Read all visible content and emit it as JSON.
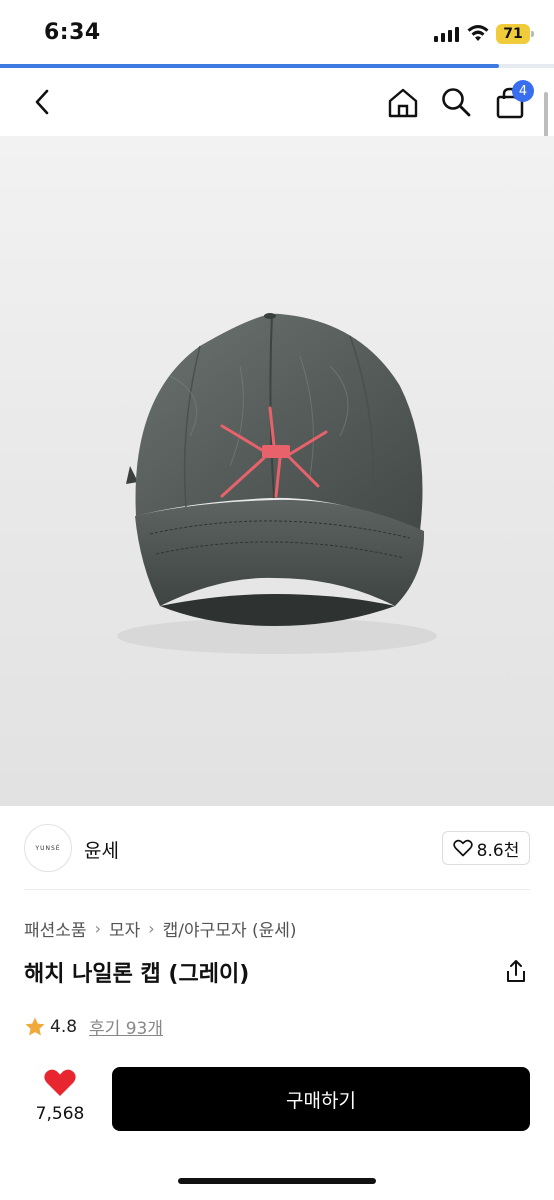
{
  "status_bar": {
    "time": "6:34",
    "battery": "71",
    "battery_color": "#f0cc3a"
  },
  "page_load_progress": 0.9,
  "header": {
    "back_icon": "chevron-left-icon",
    "home_icon": "home-icon",
    "search_icon": "search-icon",
    "cart_icon": "shopping-bag-icon",
    "cart_badge": "4",
    "badge_color": "#3a6ef0"
  },
  "product_image": {
    "subject": "gray nylon cap with pink star embroidery"
  },
  "brand": {
    "logo_text": "YUNSÉ",
    "name": "윤세",
    "likes": "8.6천"
  },
  "breadcrumb": [
    "패션소품",
    "모자",
    "캡/야구모자 (윤세)"
  ],
  "product": {
    "title": "해치 나일론 캡 (그레이)",
    "rating": "4.8",
    "reviews_label": "후기 93개"
  },
  "purchase": {
    "wish_count": "7,568",
    "buy_label": "구매하기",
    "wish_color": "#e8262f"
  }
}
